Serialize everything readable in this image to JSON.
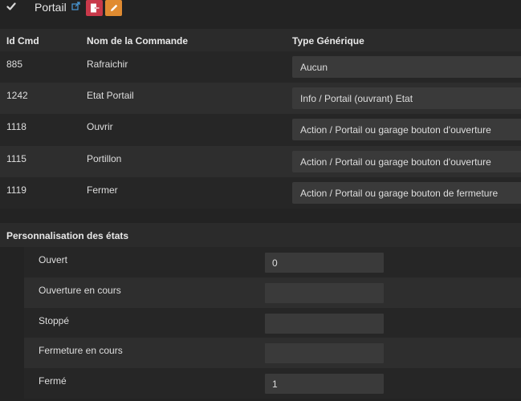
{
  "header": {
    "title": "Portail",
    "icons": {
      "checkbox": "check-icon",
      "link": "external-link-icon",
      "remove": "remove-icon",
      "edit": "pencil-icon"
    },
    "colors": {
      "remove_button": "#c9394a",
      "edit_button": "#e08b31"
    }
  },
  "table": {
    "columns": [
      "Id Cmd",
      "Nom de la Commande",
      "Type Générique"
    ],
    "rows": [
      {
        "id": "885",
        "name": "Rafraichir",
        "type": "Aucun"
      },
      {
        "id": "1242",
        "name": "Etat Portail",
        "type": "Info / Portail (ouvrant) Etat"
      },
      {
        "id": "1118",
        "name": "Ouvrir",
        "type": "Action / Portail ou garage bouton d'ouverture"
      },
      {
        "id": "1115",
        "name": "Portillon",
        "type": "Action / Portail ou garage bouton d'ouverture"
      },
      {
        "id": "1119",
        "name": "Fermer",
        "type": "Action / Portail ou garage bouton de fermeture"
      }
    ]
  },
  "states": {
    "title": "Personnalisation des états",
    "items": [
      {
        "label": "Ouvert",
        "value": "0"
      },
      {
        "label": "Ouverture en cours",
        "value": ""
      },
      {
        "label": "Stoppé",
        "value": ""
      },
      {
        "label": "Fermeture en cours",
        "value": ""
      },
      {
        "label": "Fermé",
        "value": "1"
      }
    ]
  }
}
